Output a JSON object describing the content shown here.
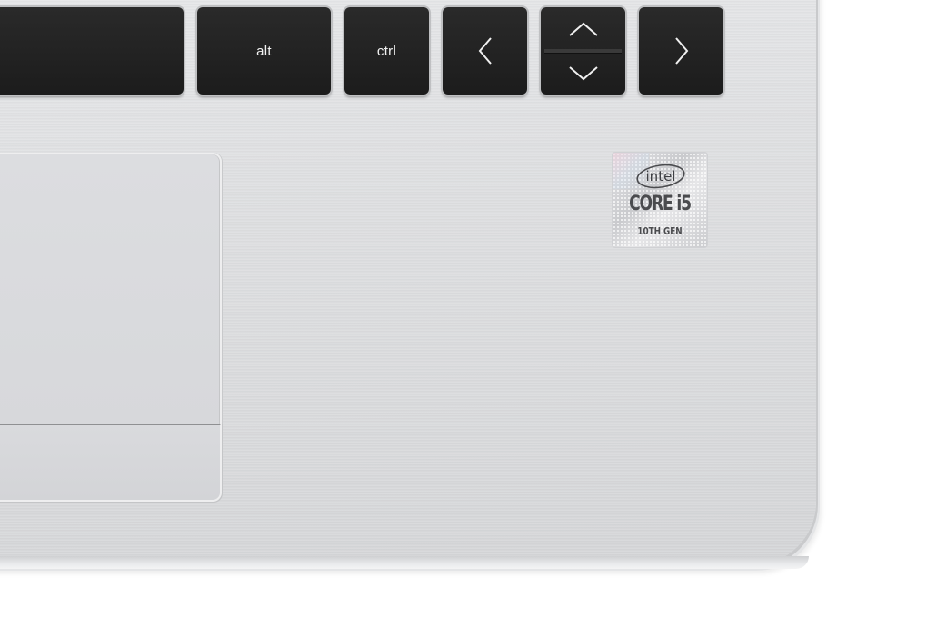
{
  "keyboard": {
    "keys": {
      "alt_label": "alt",
      "ctrl_label": "ctrl"
    }
  },
  "sticker": {
    "brand": "intel",
    "product": "CORE i5",
    "generation": "10TH GEN"
  },
  "colors": {
    "key_black": "#1f1f1f",
    "deck_silver": "#dcdddf",
    "sticker_text": "#4a4b4e"
  }
}
